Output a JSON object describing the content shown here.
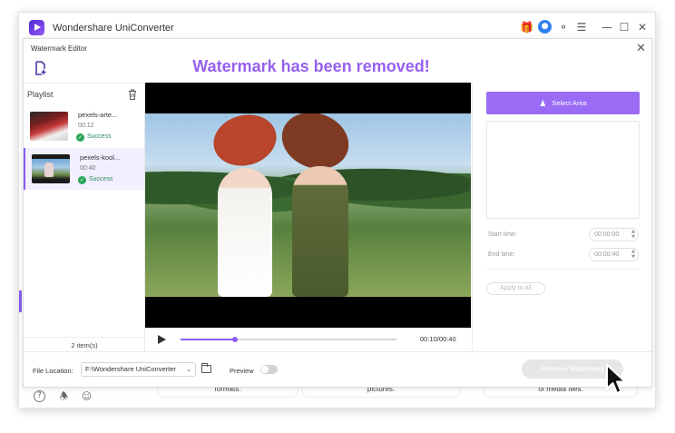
{
  "app": {
    "title": "Wondershare UniConverter",
    "accent_color": "#8a5cf5",
    "success_color": "#2aa55b"
  },
  "titlebar_icons": [
    "gift-icon",
    "user-avatar-icon",
    "headset-icon",
    "menu-icon",
    "minimize-icon",
    "maximize-icon",
    "close-icon"
  ],
  "editor": {
    "title": "Watermark Editor",
    "banner": "Watermark has been removed!"
  },
  "playlist": {
    "title": "Playlist",
    "items": [
      {
        "name": "pexels-arte...",
        "duration": "00:12",
        "status": "Success"
      },
      {
        "name": "pexels-kool...",
        "duration": "00:40",
        "status": "Success"
      }
    ],
    "count": "2 item(s)"
  },
  "player": {
    "time": "00:10/00:40",
    "progress": 0.25
  },
  "right_panel": {
    "select_area_label": "Select Area",
    "start_time_label": "Start time:",
    "start_time_value": "00:00:00",
    "end_time_label": "End time:",
    "end_time_value": "00:00:40",
    "apply_all_label": "Apply to All"
  },
  "bottom": {
    "file_location_label": "File Location:",
    "file_location_value": "F:\\Wondershare UniConverter",
    "preview_label": "Preview",
    "remove_button_label": "Remove Watermark"
  },
  "background_cards": [
    "formats.",
    "pictures.",
    "of media files."
  ]
}
